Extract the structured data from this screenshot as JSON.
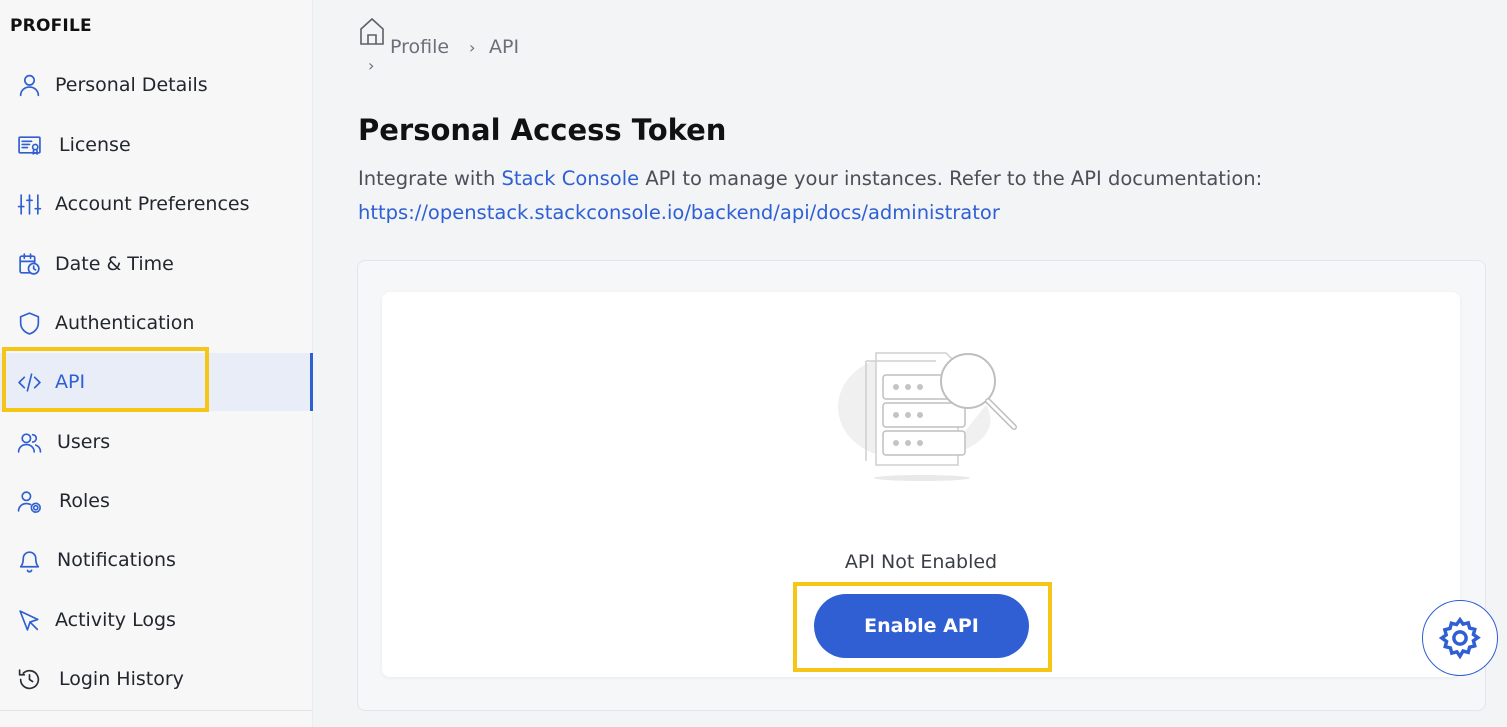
{
  "sidebar": {
    "heading": "PROFILE",
    "items": [
      {
        "label": "Personal Details",
        "icon": "user-icon"
      },
      {
        "label": "License",
        "icon": "license-icon"
      },
      {
        "label": "Account Preferences",
        "icon": "sliders-icon"
      },
      {
        "label": "Date & Time",
        "icon": "calendar-clock-icon"
      },
      {
        "label": "Authentication",
        "icon": "shield-icon"
      },
      {
        "label": "API",
        "icon": "code-icon",
        "active": true
      },
      {
        "label": "Users",
        "icon": "users-icon"
      },
      {
        "label": "Roles",
        "icon": "user-gear-icon"
      },
      {
        "label": "Notifications",
        "icon": "bell-icon"
      },
      {
        "label": "Activity Logs",
        "icon": "cursor-icon"
      },
      {
        "label": "Login History",
        "icon": "history-icon"
      }
    ]
  },
  "breadcrumb": {
    "separator": "›",
    "items": [
      "Profile",
      "API"
    ]
  },
  "main": {
    "title": "Personal Access Token",
    "desc_prefix": "Integrate with ",
    "desc_link": "Stack Console",
    "desc_suffix": " API to manage your instances. Refer to the API documentation:",
    "doc_url": "https://openstack.stackconsole.io/backend/api/docs/administrator",
    "status": "API Not Enabled",
    "enable_button": "Enable API"
  },
  "colors": {
    "accent": "#2f5fd3",
    "highlight": "#f5c518"
  }
}
